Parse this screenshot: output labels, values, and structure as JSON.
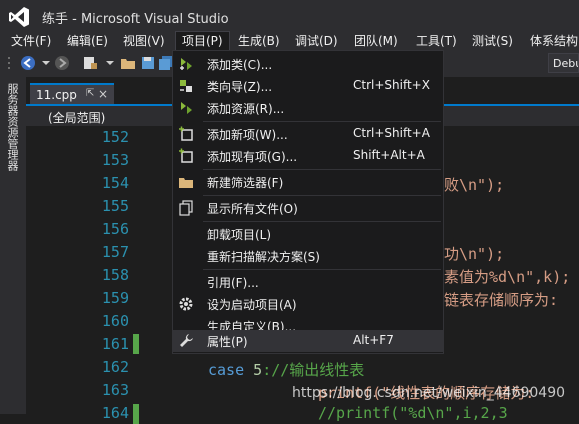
{
  "window": {
    "title": "练手 - Microsoft Visual Studio"
  },
  "menubar": [
    {
      "label": "文件(F)"
    },
    {
      "label": "编辑(E)"
    },
    {
      "label": "视图(V)"
    },
    {
      "label": "项目(P)"
    },
    {
      "label": "生成(B)"
    },
    {
      "label": "调试(D)"
    },
    {
      "label": "团队(M)"
    },
    {
      "label": "工具(T)"
    },
    {
      "label": "测试(S)"
    },
    {
      "label": "体系结构"
    }
  ],
  "toolbar": {
    "config_combo": "Debu"
  },
  "side_panel": {
    "label": "服务器资源管理器"
  },
  "tab": {
    "label": "11.cpp",
    "pin": "⇱",
    "close": "×"
  },
  "nav": {
    "scope": "(全局范围)"
  },
  "editor": {
    "line_numbers": [
      "152",
      "153",
      "154",
      "155",
      "156",
      "157",
      "158",
      "159",
      "160",
      "161",
      "162",
      "163",
      "164"
    ],
    "fragments": [
      "败\\n\");",
      "功\\n\");",
      "素值为%d\\n\",k);",
      "链表存储顺序为:",
      "printf(\"线性表的顺序存储为:",
      "//printf(\"%d\\n\",i,2,3"
    ],
    "case_line": {
      "keyword": "case",
      "number": " 5",
      "comment": "://输出线性表"
    }
  },
  "watermark": "https://blog.csdn.net/weixin_44690490",
  "project_menu": {
    "items": [
      {
        "label": "添加类(C)...",
        "shortcut": "",
        "icon": "add-class-icon"
      },
      {
        "label": "类向导(Z)...",
        "shortcut": "Ctrl+Shift+X",
        "icon": "class-wizard-icon"
      },
      {
        "label": "添加资源(R)...",
        "shortcut": "",
        "icon": "add-resource-icon"
      },
      {
        "label": "添加新项(W)...",
        "shortcut": "Ctrl+Shift+A",
        "icon": "add-new-item-icon"
      },
      {
        "label": "添加现有项(G)...",
        "shortcut": "Shift+Alt+A",
        "icon": "add-existing-item-icon"
      },
      {
        "label": "新建筛选器(F)",
        "shortcut": "",
        "icon": "folder-icon"
      },
      {
        "label": "显示所有文件(O)",
        "shortcut": "",
        "icon": "show-all-files-icon"
      },
      {
        "label": "卸载项目(L)",
        "shortcut": "",
        "icon": ""
      },
      {
        "label": "重新扫描解决方案(S)",
        "shortcut": "",
        "icon": ""
      },
      {
        "label": "引用(F)...",
        "shortcut": "",
        "icon": ""
      },
      {
        "label": "设为启动项目(A)",
        "shortcut": "",
        "icon": "gear-icon"
      },
      {
        "label": "生成自定义(B)...",
        "shortcut": "",
        "icon": ""
      },
      {
        "label": "属性(P)",
        "shortcut": "Alt+F7",
        "icon": "wrench-icon"
      }
    ]
  },
  "colors": {
    "accent": "#007acc",
    "background": "#1e1e1e",
    "chrome": "#2d2d30",
    "menu_bg": "#1b1b1c",
    "line_number": "#2b91af",
    "string": "#d69d85",
    "change_bar": "#57a64a"
  }
}
